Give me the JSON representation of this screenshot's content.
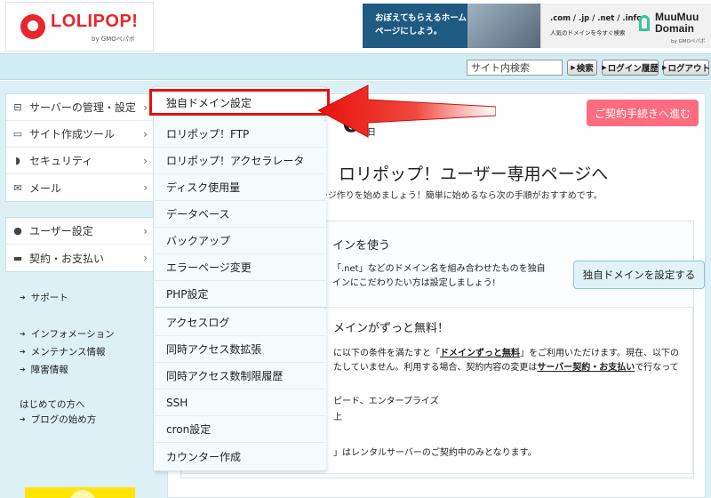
{
  "header": {
    "logo_text": "LOLIPOP!",
    "logo_sub": "by GMOペパボ",
    "banner1_text": "おぼえてもらえるホームページにしよう。",
    "banner2_tlds": ".com / .jp / .net / .info",
    "banner2_sub": "人気のドメインを今すぐ検索",
    "banner2_brand": "MuuMuu Domain",
    "banner2_by": "by GMOペパボ"
  },
  "utility": {
    "search_placeholder": "サイト内検索",
    "search_button": "検索",
    "login_history": "ログイン履歴",
    "logout": "ログアウト"
  },
  "sidebar": {
    "items": [
      {
        "label": "サーバーの管理・設定",
        "icon": "server-icon"
      },
      {
        "label": "サイト作成ツール",
        "icon": "laptop-icon"
      },
      {
        "label": "セキュリティ",
        "icon": "shield-icon"
      },
      {
        "label": "メール",
        "icon": "mail-icon"
      }
    ],
    "account_items": [
      {
        "label": "ユーザー設定",
        "icon": "user-icon"
      },
      {
        "label": "契約・お支払い",
        "icon": "card-icon"
      }
    ],
    "support": "サポート",
    "info_links": [
      "インフォメーション",
      "メンテナンス情報",
      "障害情報"
    ],
    "beginner_head": "はじめての方へ",
    "blog_link": "ブログの始め方"
  },
  "dropdown": {
    "items": [
      "独自ドメイン設定",
      "ロリポップ！FTP",
      "ロリポップ！アクセラレータ",
      "ディスク使用量",
      "データベース",
      "バックアップ",
      "エラーページ変更",
      "PHP設定",
      "アクセスログ",
      "同時アクセス数拡張",
      "同時アクセス数制限履歴",
      "SSH",
      "cron設定",
      "カウンター作成"
    ]
  },
  "main": {
    "big_digit": "6",
    "big_digit_suffix": "日",
    "contract_button": "ご契約手続きへ進む",
    "welcome": "ロリポップ！ユーザー専用ページへ",
    "welcome_sub": "ージ作りを始めましょう！簡単に始めるなら次の手順がおすすめです。",
    "card_title": "インを使う",
    "card_desc1": "「.net」などのドメイン名を組み合わせたものを独自",
    "card_desc2": "インにこだわりたい方は設定しましょう!",
    "domain_button": "独自ドメインを設定する",
    "free_title": "メインがずっと無料！",
    "free_t1_a": "に以下の条件を満たすと「",
    "free_t1_b": "ドメインずっと無料",
    "free_t1_c": "」をご利用いただけます。現在、以下の",
    "free_t2_a": "たしていません。利用する場合、契約内容の変更は",
    "free_t2_b": "サーバー契約・お支払い",
    "free_t2_c": "で行なって",
    "free_t3": "ピード、エンタープライズ",
    "free_t4": "上",
    "free_t5": "」はレンタルサーバーのご契約中のみとなります。"
  },
  "colors": {
    "brand_red": "#e8262b",
    "highlight_red": "#e8100b",
    "sidebar_bg": "#dcf0f5",
    "contract_pink": "#ff6b7f"
  }
}
